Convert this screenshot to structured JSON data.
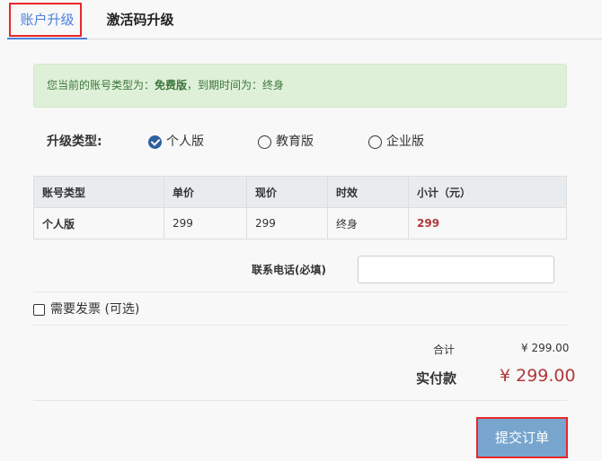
{
  "tabs": [
    {
      "label": "账户升级"
    },
    {
      "label": "激活码升级"
    }
  ],
  "alert": {
    "prefix": "您当前的账号类型为：",
    "type": "免费版",
    "mid": "，到期时间为：",
    "expiry": "终身"
  },
  "upgrade": {
    "label": "升级类型:",
    "options": [
      {
        "label": "个人版",
        "selected": true
      },
      {
        "label": "教育版",
        "selected": false
      },
      {
        "label": "企业版",
        "selected": false
      }
    ]
  },
  "table": {
    "headers": [
      "账号类型",
      "单价",
      "现价",
      "时效",
      "小计（元）"
    ],
    "row": [
      "个人版",
      "299",
      "299",
      "终身",
      "299"
    ]
  },
  "phone": {
    "label": "联系电话(必填)",
    "value": ""
  },
  "invoice": {
    "label": "需要发票 (可选)",
    "checked": false
  },
  "summary": {
    "total_label": "合计",
    "total_value": "¥ 299.00",
    "pay_label": "实付款",
    "pay_value": "¥ 299.00"
  },
  "submit_label": "提交订单",
  "colors": {
    "accent": "#4a7fe0",
    "price": "#b0383a",
    "button": "#77a5cd",
    "highlight": "#e8272b"
  }
}
